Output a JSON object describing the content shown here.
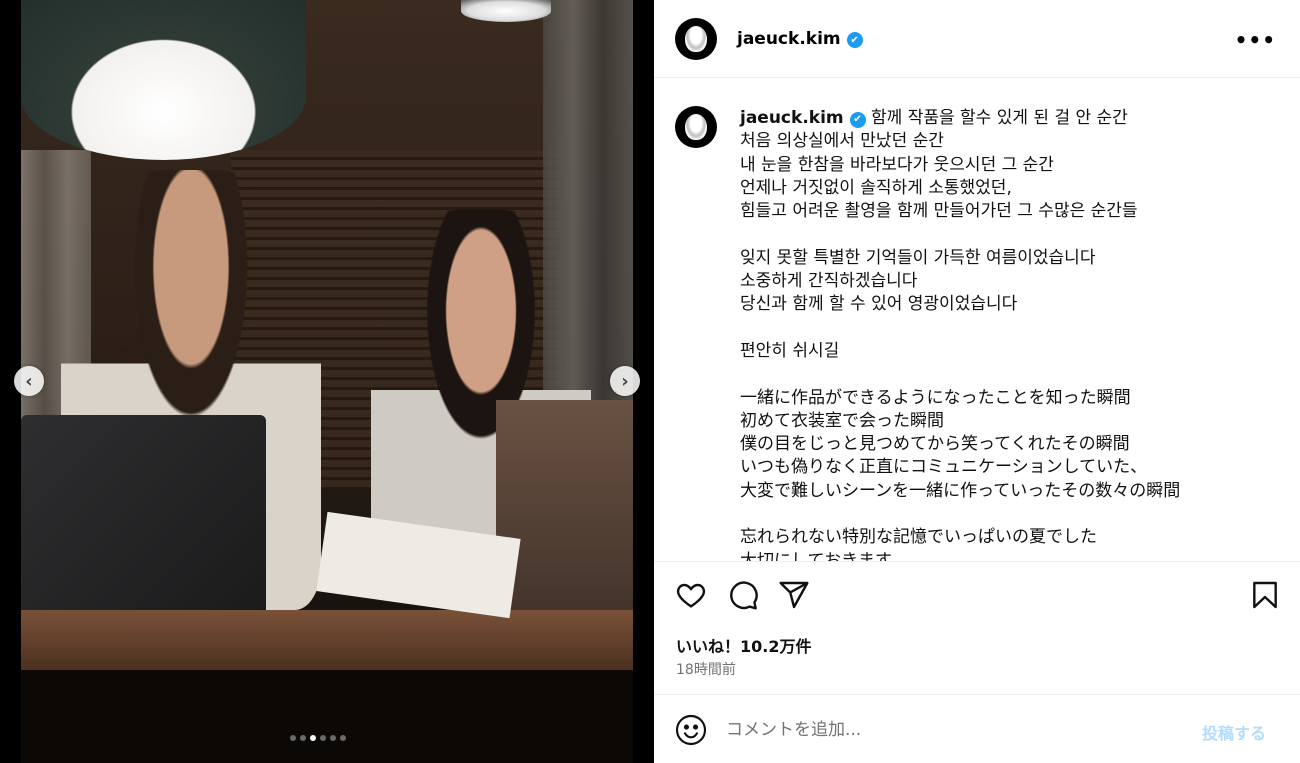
{
  "post": {
    "username": "jaeuck.kim",
    "verified_mark": "✔",
    "more_label": "•••",
    "caption_lines": "함께 작품을 할수 있게 된 걸 안 순간\n처음 의상실에서 만났던 순간\n내 눈을 한참을 바라보다가 웃으시던 그 순간\n언제나 거짓없이 솔직하게 소통했었던,\n힘들고 어려운 촬영을 함께 만들어가던 그 수많은 순간들\n\n잊지 못할 특별한 기억들이 가득한 여름이었습니다\n소중하게 간직하겠습니다\n당신과 함께 할 수 있어 영광이었습니다\n\n편안히 쉬시길\n\n一緒に作品ができるようになったことを知った瞬間\n初めて衣装室で会った瞬間\n僕の目をじっと見つめてから笑ってくれたその瞬間\nいつも偽りなく正直にコミュニケーションしていた、\n大変で難しいシーンを一緒に作っていったその数々の瞬間\n\n忘れられない特別な記憶でいっぱいの夏でした\n大切にしておきます",
    "likes": "いいね！10.2万件",
    "time_ago": "18時間前"
  },
  "carousel": {
    "prev_label": "‹",
    "next_label": "›",
    "total_slides": 6,
    "active_slide": 3
  },
  "comment": {
    "placeholder": "コメントを追加...",
    "post_label": "投稿する"
  },
  "icons": {
    "like": "heart-icon",
    "comment": "comment-icon",
    "share": "share-icon",
    "save": "bookmark-icon",
    "emoji": "emoji-icon",
    "more": "more-icon"
  },
  "colors": {
    "verified": "#1d9bf0",
    "post_button_disabled": "#b3dbff",
    "secondary_text": "#737373"
  }
}
